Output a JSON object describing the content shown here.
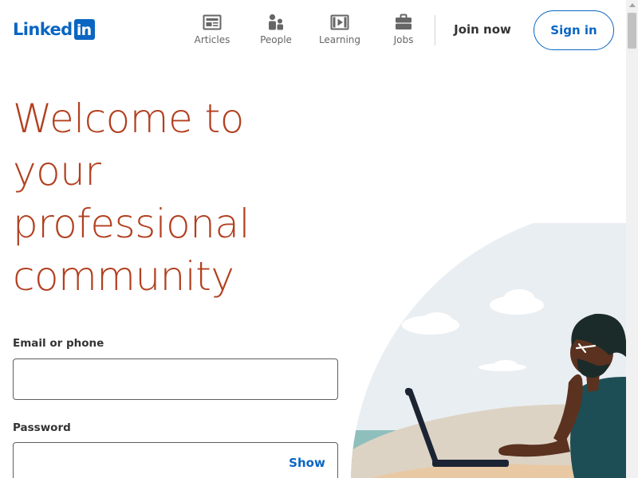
{
  "header": {
    "logo": {
      "word": "Linked",
      "box": "in"
    },
    "nav": [
      {
        "label": "Articles",
        "icon": "articles-icon"
      },
      {
        "label": "People",
        "icon": "people-icon"
      },
      {
        "label": "Learning",
        "icon": "learning-icon"
      },
      {
        "label": "Jobs",
        "icon": "briefcase-icon"
      }
    ],
    "join_label": "Join now",
    "signin_label": "Sign in"
  },
  "hero": {
    "title_lines": [
      "Welcome to",
      "your",
      "professional",
      "community"
    ]
  },
  "form": {
    "email_label": "Email or phone",
    "email_value": "",
    "password_label": "Password",
    "password_value": "",
    "show_label": "Show"
  },
  "colors": {
    "brand_blue": "#0a66c2",
    "headline": "#b24020",
    "nav_text": "#666666",
    "body_text": "#333333"
  }
}
